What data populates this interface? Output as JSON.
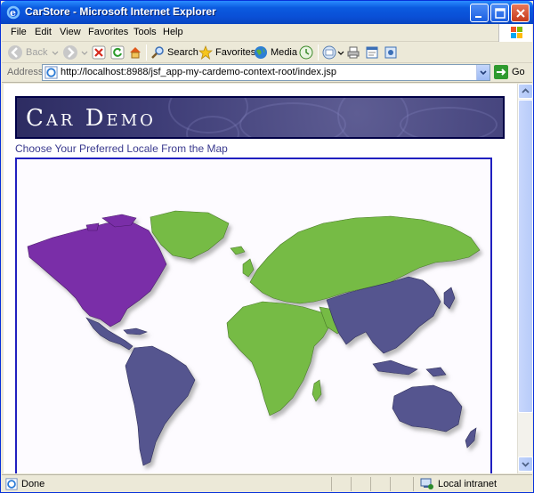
{
  "window": {
    "title": "CarStore - Microsoft Internet Explorer"
  },
  "menu": [
    "File",
    "Edit",
    "View",
    "Favorites",
    "Tools",
    "Help"
  ],
  "toolbar": {
    "back": "Back",
    "search": "Search",
    "favorites": "Favorites",
    "media": "Media"
  },
  "address": {
    "label": "Address",
    "url": "http://localhost:8988/jsf_app-my-cardemo-context-root/index.jsp",
    "go": "Go"
  },
  "page": {
    "banner_title": "Car Demo",
    "locale_heading": "Choose Your Preferred Locale From the Map",
    "map_colors": {
      "purple": "#7a2fa8",
      "green": "#76bb44",
      "slate": "#55558f"
    }
  },
  "status": {
    "left": "Done",
    "zone": "Local intranet"
  }
}
